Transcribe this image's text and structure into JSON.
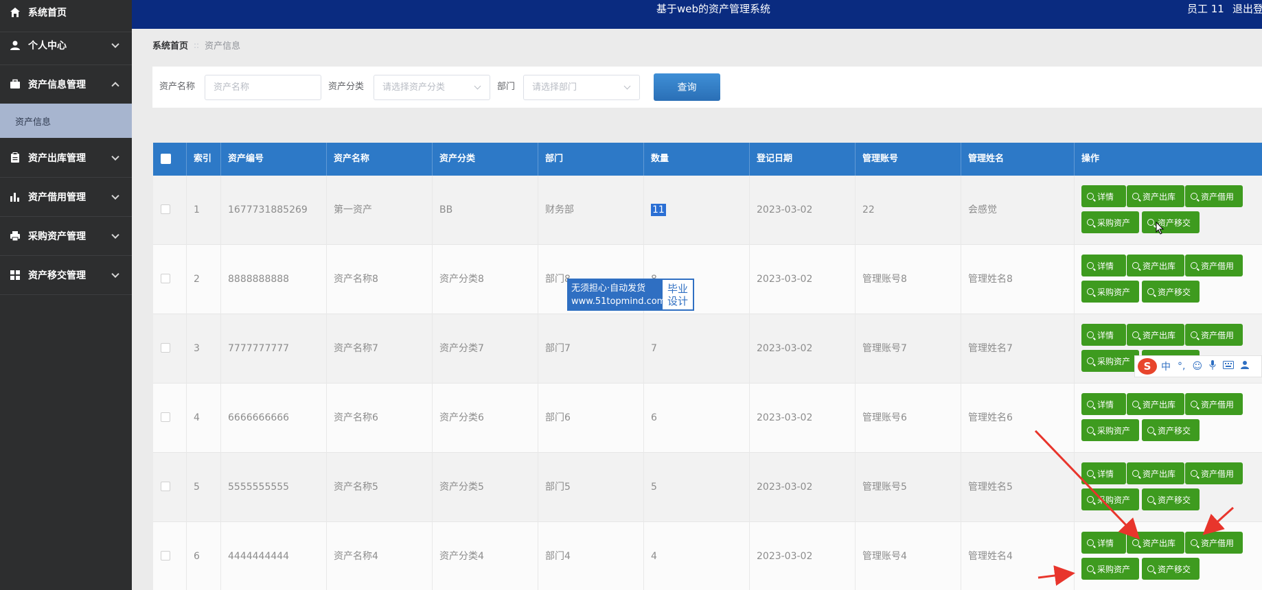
{
  "sidebar": {
    "items": [
      {
        "label": "系统首页",
        "icon": "home-icon"
      },
      {
        "label": "个人中心",
        "icon": "user-icon"
      },
      {
        "label": "资产信息管理",
        "icon": "briefcase-icon"
      },
      {
        "label": "资产出库管理",
        "icon": "clipboard-icon"
      },
      {
        "label": "资产借用管理",
        "icon": "bar-chart-icon"
      },
      {
        "label": "采购资产管理",
        "icon": "printer-icon"
      },
      {
        "label": "资产移交管理",
        "icon": "grid-icon"
      }
    ],
    "active_sub": "资产信息"
  },
  "header": {
    "title": "基于web的资产管理系统",
    "user": "员工 11",
    "logout": "退出登"
  },
  "breadcrumb": {
    "home": "系统首页",
    "separator": "::",
    "current": "资产信息"
  },
  "search": {
    "name_label": "资产名称",
    "name_placeholder": "资产名称",
    "category_label": "资产分类",
    "category_placeholder": "请选择资产分类",
    "dept_label": "部门",
    "dept_placeholder": "请选择部门",
    "query_button": "查询"
  },
  "table": {
    "columns": [
      "索引",
      "资产编号",
      "资产名称",
      "资产分类",
      "部门",
      "数量",
      "登记日期",
      "管理账号",
      "管理姓名",
      "操作"
    ],
    "rows": [
      {
        "index": "1",
        "code": "1677731885269",
        "name": "第一资产",
        "category": "BB",
        "dept": "财务部",
        "qty": "11",
        "date": "2023-03-02",
        "account": "22",
        "manager": "会感觉"
      },
      {
        "index": "2",
        "code": "8888888888",
        "name": "资产名称8",
        "category": "资产分类8",
        "dept": "部门8",
        "qty": "8",
        "date": "2023-03-02",
        "account": "管理账号8",
        "manager": "管理姓名8"
      },
      {
        "index": "3",
        "code": "7777777777",
        "name": "资产名称7",
        "category": "资产分类7",
        "dept": "部门7",
        "qty": "7",
        "date": "2023-03-02",
        "account": "管理账号7",
        "manager": "管理姓名7"
      },
      {
        "index": "4",
        "code": "6666666666",
        "name": "资产名称6",
        "category": "资产分类6",
        "dept": "部门6",
        "qty": "6",
        "date": "2023-03-02",
        "account": "管理账号6",
        "manager": "管理姓名6"
      },
      {
        "index": "5",
        "code": "5555555555",
        "name": "资产名称5",
        "category": "资产分类5",
        "dept": "部门5",
        "qty": "5",
        "date": "2023-03-02",
        "account": "管理账号5",
        "manager": "管理姓名5"
      },
      {
        "index": "6",
        "code": "4444444444",
        "name": "资产名称4",
        "category": "资产分类4",
        "dept": "部门4",
        "qty": "4",
        "date": "2023-03-02",
        "account": "管理账号4",
        "manager": "管理姓名4"
      }
    ],
    "actions": [
      "详情",
      "资产出库",
      "资产借用",
      "采购资产",
      "资产移交"
    ]
  },
  "watermark": {
    "line1": "无须担心·自动发货",
    "line2": "www.51topmind.com",
    "right1": "毕业",
    "right2": "设计"
  },
  "ime": {
    "logo": "S",
    "lang": "中",
    "punct": "°,"
  },
  "colors": {
    "sidebar_bg": "#2d2e2f",
    "header_bg": "#0a2b80",
    "table_header_bg": "#2d79c7",
    "action_button": "#3e9b1f",
    "annotation_arrow": "#e8352c"
  }
}
